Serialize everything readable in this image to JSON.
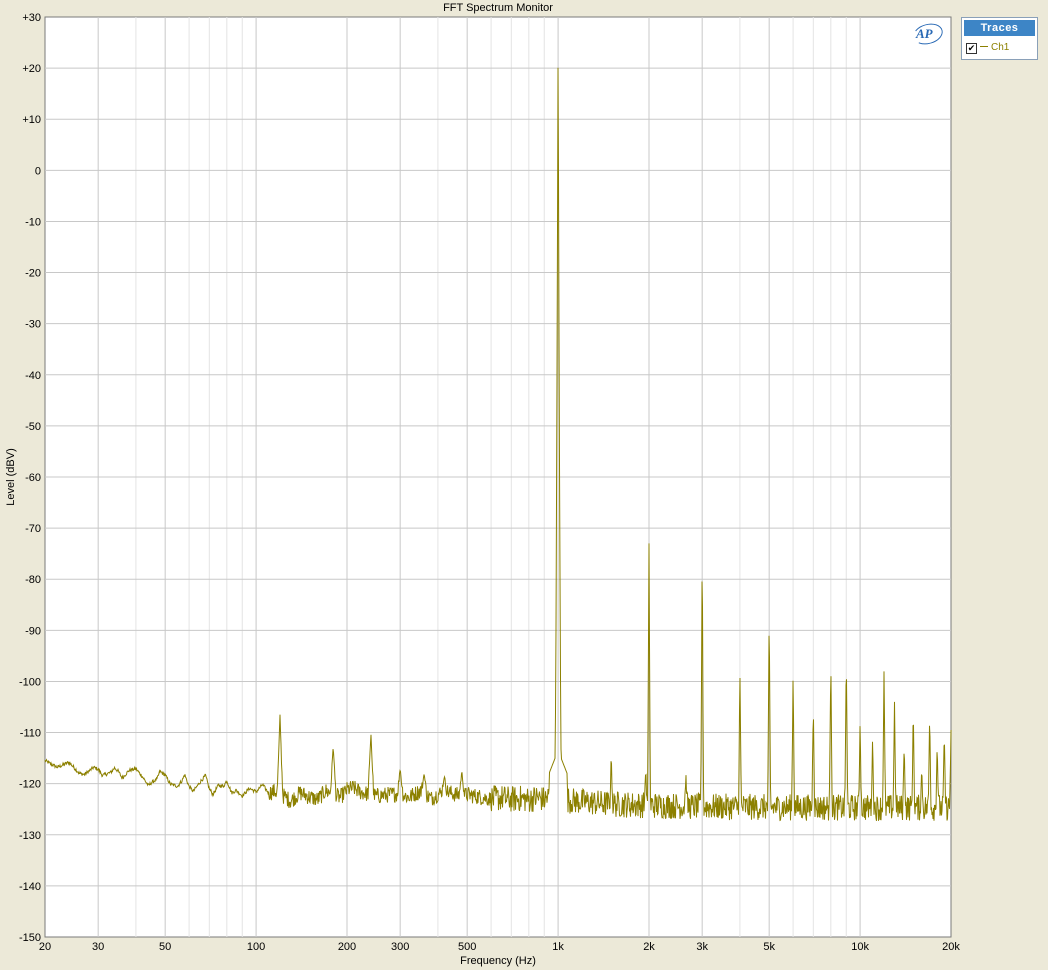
{
  "window": {
    "title": "FFT Spectrum Monitor"
  },
  "logo": {
    "text": "AP"
  },
  "traces_panel": {
    "header": "Traces",
    "items": [
      {
        "label": "Ch1",
        "checked": true,
        "check_glyph": "✔",
        "color": "#8c8000"
      }
    ]
  },
  "chart_data": {
    "type": "line",
    "title": "FFT Spectrum Monitor",
    "xlabel": "Frequency (Hz)",
    "ylabel": "Level (dBV)",
    "xscale": "log",
    "xlim": [
      20,
      20000
    ],
    "ylim": [
      -150,
      30
    ],
    "grid": true,
    "legend_placement": "right",
    "x_ticks": [
      {
        "v": 20,
        "label": "20"
      },
      {
        "v": 30,
        "label": "30"
      },
      {
        "v": 50,
        "label": "50"
      },
      {
        "v": 100,
        "label": "100"
      },
      {
        "v": 200,
        "label": "200"
      },
      {
        "v": 300,
        "label": "300"
      },
      {
        "v": 500,
        "label": "500"
      },
      {
        "v": 1000,
        "label": "1k"
      },
      {
        "v": 2000,
        "label": "2k"
      },
      {
        "v": 3000,
        "label": "3k"
      },
      {
        "v": 5000,
        "label": "5k"
      },
      {
        "v": 10000,
        "label": "10k"
      },
      {
        "v": 20000,
        "label": "20k"
      }
    ],
    "y_ticks": [
      {
        "v": 30,
        "label": "+30"
      },
      {
        "v": 20,
        "label": "+20"
      },
      {
        "v": 10,
        "label": "+10"
      },
      {
        "v": 0,
        "label": "0"
      },
      {
        "v": -10,
        "label": "-10"
      },
      {
        "v": -20,
        "label": "-20"
      },
      {
        "v": -30,
        "label": "-30"
      },
      {
        "v": -40,
        "label": "-40"
      },
      {
        "v": -50,
        "label": "-50"
      },
      {
        "v": -60,
        "label": "-60"
      },
      {
        "v": -70,
        "label": "-70"
      },
      {
        "v": -80,
        "label": "-80"
      },
      {
        "v": -90,
        "label": "-90"
      },
      {
        "v": -100,
        "label": "-100"
      },
      {
        "v": -110,
        "label": "-110"
      },
      {
        "v": -120,
        "label": "-120"
      },
      {
        "v": -130,
        "label": "-130"
      },
      {
        "v": -140,
        "label": "-140"
      },
      {
        "v": -150,
        "label": "-150"
      }
    ],
    "series": [
      {
        "name": "Ch1",
        "color": "#8c8000",
        "noise_floor_points": [
          [
            20,
            -115.5
          ],
          [
            21,
            -116.2
          ],
          [
            22,
            -116.8
          ],
          [
            23,
            -116.3
          ],
          [
            24,
            -115.8
          ],
          [
            25,
            -116.9
          ],
          [
            26,
            -118.0
          ],
          [
            27,
            -118.2
          ],
          [
            28,
            -117.5
          ],
          [
            29,
            -116.8
          ],
          [
            30,
            -117.2
          ],
          [
            31,
            -118.4
          ],
          [
            33,
            -117.8
          ],
          [
            34,
            -116.9
          ],
          [
            35,
            -117.6
          ],
          [
            36,
            -118.9
          ],
          [
            38,
            -117.4
          ],
          [
            40,
            -117.1
          ],
          [
            42,
            -118.6
          ],
          [
            44,
            -120.4
          ],
          [
            45,
            -119.8
          ],
          [
            47,
            -119.1
          ],
          [
            48,
            -117.6
          ],
          [
            50,
            -118.3
          ],
          [
            52,
            -120.1
          ],
          [
            55,
            -120.5
          ],
          [
            57,
            -119.3
          ],
          [
            58,
            -118.2
          ],
          [
            60,
            -120.6
          ],
          [
            62,
            -121.5
          ],
          [
            65,
            -119.8
          ],
          [
            68,
            -118.4
          ],
          [
            70,
            -121.0
          ],
          [
            72,
            -122.1
          ],
          [
            75,
            -120.3
          ],
          [
            78,
            -120.5
          ],
          [
            80,
            -119.4
          ],
          [
            83,
            -121.8
          ],
          [
            86,
            -121.3
          ],
          [
            90,
            -122.4
          ],
          [
            95,
            -120.9
          ],
          [
            100,
            -121.6
          ],
          [
            105,
            -120.2
          ],
          [
            110,
            -121.8
          ],
          [
            115,
            -121.5
          ],
          [
            125,
            -122.6
          ],
          [
            130,
            -123.4
          ],
          [
            140,
            -121.8
          ],
          [
            150,
            -122.6
          ],
          [
            160,
            -123.1
          ],
          [
            170,
            -121.4
          ],
          [
            190,
            -122.7
          ],
          [
            200,
            -121.2
          ],
          [
            210,
            -120.8
          ],
          [
            220,
            -121.6
          ],
          [
            250,
            -122.4
          ],
          [
            280,
            -122.1
          ],
          [
            300,
            -121.9
          ],
          [
            320,
            -122.7
          ],
          [
            350,
            -121.4
          ],
          [
            380,
            -122.9
          ],
          [
            400,
            -122.0
          ],
          [
            430,
            -121.6
          ],
          [
            480,
            -122.5
          ],
          [
            500,
            -122.1
          ],
          [
            550,
            -122.6
          ],
          [
            600,
            -123.0
          ],
          [
            650,
            -122.8
          ],
          [
            700,
            -123.1
          ],
          [
            750,
            -122.9
          ],
          [
            800,
            -123.2
          ],
          [
            850,
            -122.7
          ],
          [
            900,
            -123.1
          ],
          [
            950,
            -122.4
          ],
          [
            1100,
            -123.3
          ],
          [
            1200,
            -123.5
          ],
          [
            1500,
            -124.0
          ],
          [
            2000,
            -124.2
          ],
          [
            3000,
            -124.5
          ],
          [
            5000,
            -124.6
          ],
          [
            10000,
            -124.7
          ],
          [
            20000,
            -124.7
          ]
        ],
        "peaks": [
          {
            "f": 120,
            "level": -106.5
          },
          {
            "f": 180,
            "level": -112.5
          },
          {
            "f": 240,
            "level": -110.0
          },
          {
            "f": 300,
            "level": -117.0
          },
          {
            "f": 360,
            "level": -118.0
          },
          {
            "f": 420,
            "level": -118.5
          },
          {
            "f": 480,
            "level": -117.5
          },
          {
            "f": 960,
            "level": -116.5
          },
          {
            "f": 1000,
            "level": 26.0
          },
          {
            "f": 1500,
            "level": -114.0
          },
          {
            "f": 1950,
            "level": -117.0
          },
          {
            "f": 2000,
            "level": -73.0
          },
          {
            "f": 2650,
            "level": -118.0
          },
          {
            "f": 3000,
            "level": -73.0
          },
          {
            "f": 4000,
            "level": -97.5
          },
          {
            "f": 5000,
            "level": -86.0
          },
          {
            "f": 6000,
            "level": -98.0
          },
          {
            "f": 7000,
            "level": -104.0
          },
          {
            "f": 8000,
            "level": -94.5
          },
          {
            "f": 9000,
            "level": -94.0
          },
          {
            "f": 10000,
            "level": -107.5
          },
          {
            "f": 11000,
            "level": -111.0
          },
          {
            "f": 12000,
            "level": -98.0
          },
          {
            "f": 13000,
            "level": -104.0
          },
          {
            "f": 14000,
            "level": -112.0
          },
          {
            "f": 15000,
            "level": -105.0
          },
          {
            "f": 16000,
            "level": -117.0
          },
          {
            "f": 17000,
            "level": -106.0
          },
          {
            "f": 18000,
            "level": -112.0
          },
          {
            "f": 19000,
            "level": -110.0
          },
          {
            "f": 20000,
            "level": -109.5
          }
        ]
      }
    ]
  }
}
